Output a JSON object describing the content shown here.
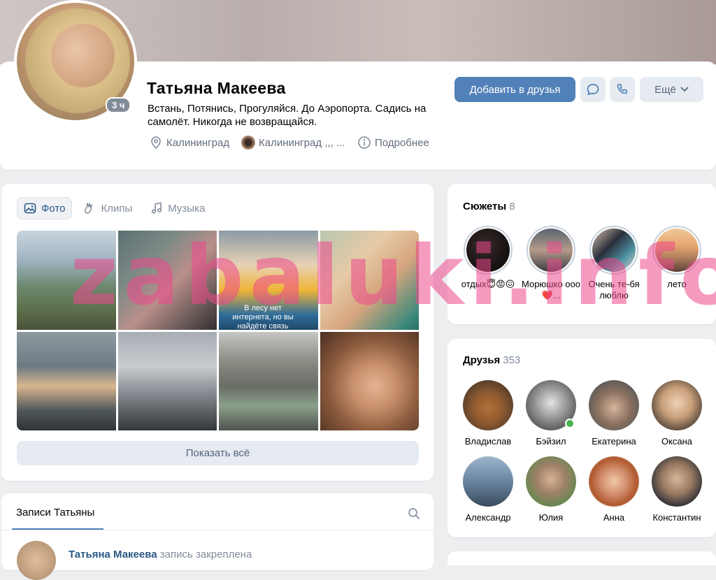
{
  "profile": {
    "name": "Татьяна Макеева",
    "avatar_badge": "3 ч",
    "status": "Встань, Потянись, Прогуляйся. До Аэропорта. Садись на самолёт. Никогда не возвращайся.",
    "location": "Калининград",
    "school": "Калининград ,,, ...",
    "details_label": "Подробнее"
  },
  "actions": {
    "add_friend": "Добавить в друзья",
    "message_icon": "message-icon",
    "call_icon": "phone-icon",
    "more_label": "Ещё"
  },
  "media": {
    "tabs": [
      {
        "label": "Фото",
        "icon": "photo-icon",
        "active": true
      },
      {
        "label": "Клипы",
        "icon": "clips-icon",
        "active": false
      },
      {
        "label": "Музыка",
        "icon": "music-icon",
        "active": false
      }
    ],
    "photo_overlay_text": "В лесу нет интернета, но вы найдёте связь",
    "show_all": "Показать всё"
  },
  "wall": {
    "tab_label": "Записи Татьяны",
    "post_author": "Татьяна Макеева",
    "post_note": "запись закреплена"
  },
  "stories": {
    "title": "Сюжеты",
    "count": "8",
    "items": [
      {
        "label": "отдых😇😡😖"
      },
      {
        "label": "Морюшко ооо❤️..."
      },
      {
        "label": "Очень те-бя люблю"
      },
      {
        "label": "лето"
      }
    ]
  },
  "friends": {
    "title": "Друзья",
    "count": "353",
    "items": [
      {
        "name": "Владислав",
        "online": false
      },
      {
        "name": "Бэйзил",
        "online": true
      },
      {
        "name": "Екатерина",
        "online": false
      },
      {
        "name": "Оксана",
        "online": false
      },
      {
        "name": "Александр",
        "online": false
      },
      {
        "name": "Юлия",
        "online": false
      },
      {
        "name": "Анна",
        "online": false
      },
      {
        "name": "Константин",
        "online": false
      }
    ]
  },
  "watermark": "zabaluki.info",
  "colors": {
    "accent": "#5181b8",
    "link": "#2a5885",
    "secondary_text": "#818c99",
    "background": "#edeef0",
    "online": "#4bb34b"
  }
}
